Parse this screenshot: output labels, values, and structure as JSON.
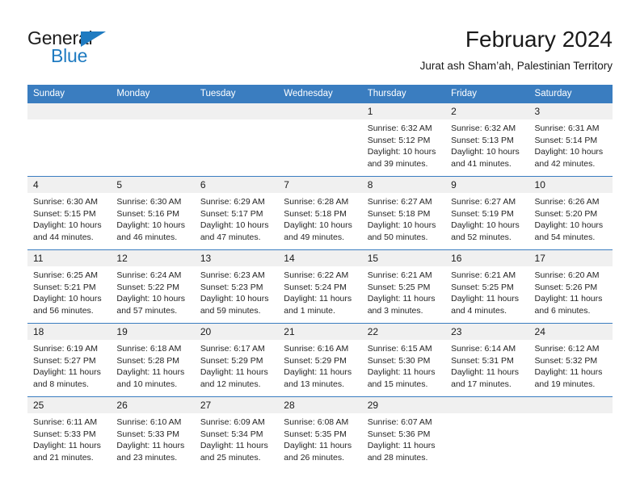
{
  "brand": {
    "name_dark": "General",
    "name_blue": "Blue",
    "accent_color": "#1f7bc1"
  },
  "header": {
    "title": "February 2024",
    "subtitle": "Jurat ash Sham’ah, Palestinian Territory"
  },
  "theme": {
    "header_row_bg": "#3a7dc0",
    "daynum_band_bg": "#f0f0f0",
    "row_divider": "#3a7dc0",
    "text": "#1a1a1a"
  },
  "calendar": {
    "weekday_headers": [
      "Sunday",
      "Monday",
      "Tuesday",
      "Wednesday",
      "Thursday",
      "Friday",
      "Saturday"
    ],
    "weeks": [
      [
        {
          "day": "",
          "empty": true,
          "lines": []
        },
        {
          "day": "",
          "empty": true,
          "lines": []
        },
        {
          "day": "",
          "empty": true,
          "lines": []
        },
        {
          "day": "",
          "empty": true,
          "lines": []
        },
        {
          "day": "1",
          "lines": [
            "Sunrise: 6:32 AM",
            "Sunset: 5:12 PM",
            "Daylight: 10 hours",
            "and 39 minutes."
          ]
        },
        {
          "day": "2",
          "lines": [
            "Sunrise: 6:32 AM",
            "Sunset: 5:13 PM",
            "Daylight: 10 hours",
            "and 41 minutes."
          ]
        },
        {
          "day": "3",
          "lines": [
            "Sunrise: 6:31 AM",
            "Sunset: 5:14 PM",
            "Daylight: 10 hours",
            "and 42 minutes."
          ]
        }
      ],
      [
        {
          "day": "4",
          "lines": [
            "Sunrise: 6:30 AM",
            "Sunset: 5:15 PM",
            "Daylight: 10 hours",
            "and 44 minutes."
          ]
        },
        {
          "day": "5",
          "lines": [
            "Sunrise: 6:30 AM",
            "Sunset: 5:16 PM",
            "Daylight: 10 hours",
            "and 46 minutes."
          ]
        },
        {
          "day": "6",
          "lines": [
            "Sunrise: 6:29 AM",
            "Sunset: 5:17 PM",
            "Daylight: 10 hours",
            "and 47 minutes."
          ]
        },
        {
          "day": "7",
          "lines": [
            "Sunrise: 6:28 AM",
            "Sunset: 5:18 PM",
            "Daylight: 10 hours",
            "and 49 minutes."
          ]
        },
        {
          "day": "8",
          "lines": [
            "Sunrise: 6:27 AM",
            "Sunset: 5:18 PM",
            "Daylight: 10 hours",
            "and 50 minutes."
          ]
        },
        {
          "day": "9",
          "lines": [
            "Sunrise: 6:27 AM",
            "Sunset: 5:19 PM",
            "Daylight: 10 hours",
            "and 52 minutes."
          ]
        },
        {
          "day": "10",
          "lines": [
            "Sunrise: 6:26 AM",
            "Sunset: 5:20 PM",
            "Daylight: 10 hours",
            "and 54 minutes."
          ]
        }
      ],
      [
        {
          "day": "11",
          "lines": [
            "Sunrise: 6:25 AM",
            "Sunset: 5:21 PM",
            "Daylight: 10 hours",
            "and 56 minutes."
          ]
        },
        {
          "day": "12",
          "lines": [
            "Sunrise: 6:24 AM",
            "Sunset: 5:22 PM",
            "Daylight: 10 hours",
            "and 57 minutes."
          ]
        },
        {
          "day": "13",
          "lines": [
            "Sunrise: 6:23 AM",
            "Sunset: 5:23 PM",
            "Daylight: 10 hours",
            "and 59 minutes."
          ]
        },
        {
          "day": "14",
          "lines": [
            "Sunrise: 6:22 AM",
            "Sunset: 5:24 PM",
            "Daylight: 11 hours",
            "and 1 minute."
          ]
        },
        {
          "day": "15",
          "lines": [
            "Sunrise: 6:21 AM",
            "Sunset: 5:25 PM",
            "Daylight: 11 hours",
            "and 3 minutes."
          ]
        },
        {
          "day": "16",
          "lines": [
            "Sunrise: 6:21 AM",
            "Sunset: 5:25 PM",
            "Daylight: 11 hours",
            "and 4 minutes."
          ]
        },
        {
          "day": "17",
          "lines": [
            "Sunrise: 6:20 AM",
            "Sunset: 5:26 PM",
            "Daylight: 11 hours",
            "and 6 minutes."
          ]
        }
      ],
      [
        {
          "day": "18",
          "lines": [
            "Sunrise: 6:19 AM",
            "Sunset: 5:27 PM",
            "Daylight: 11 hours",
            "and 8 minutes."
          ]
        },
        {
          "day": "19",
          "lines": [
            "Sunrise: 6:18 AM",
            "Sunset: 5:28 PM",
            "Daylight: 11 hours",
            "and 10 minutes."
          ]
        },
        {
          "day": "20",
          "lines": [
            "Sunrise: 6:17 AM",
            "Sunset: 5:29 PM",
            "Daylight: 11 hours",
            "and 12 minutes."
          ]
        },
        {
          "day": "21",
          "lines": [
            "Sunrise: 6:16 AM",
            "Sunset: 5:29 PM",
            "Daylight: 11 hours",
            "and 13 minutes."
          ]
        },
        {
          "day": "22",
          "lines": [
            "Sunrise: 6:15 AM",
            "Sunset: 5:30 PM",
            "Daylight: 11 hours",
            "and 15 minutes."
          ]
        },
        {
          "day": "23",
          "lines": [
            "Sunrise: 6:14 AM",
            "Sunset: 5:31 PM",
            "Daylight: 11 hours",
            "and 17 minutes."
          ]
        },
        {
          "day": "24",
          "lines": [
            "Sunrise: 6:12 AM",
            "Sunset: 5:32 PM",
            "Daylight: 11 hours",
            "and 19 minutes."
          ]
        }
      ],
      [
        {
          "day": "25",
          "lines": [
            "Sunrise: 6:11 AM",
            "Sunset: 5:33 PM",
            "Daylight: 11 hours",
            "and 21 minutes."
          ]
        },
        {
          "day": "26",
          "lines": [
            "Sunrise: 6:10 AM",
            "Sunset: 5:33 PM",
            "Daylight: 11 hours",
            "and 23 minutes."
          ]
        },
        {
          "day": "27",
          "lines": [
            "Sunrise: 6:09 AM",
            "Sunset: 5:34 PM",
            "Daylight: 11 hours",
            "and 25 minutes."
          ]
        },
        {
          "day": "28",
          "lines": [
            "Sunrise: 6:08 AM",
            "Sunset: 5:35 PM",
            "Daylight: 11 hours",
            "and 26 minutes."
          ]
        },
        {
          "day": "29",
          "lines": [
            "Sunrise: 6:07 AM",
            "Sunset: 5:36 PM",
            "Daylight: 11 hours",
            "and 28 minutes."
          ]
        },
        {
          "day": "",
          "empty": true,
          "lines": []
        },
        {
          "day": "",
          "empty": true,
          "lines": []
        }
      ]
    ]
  }
}
